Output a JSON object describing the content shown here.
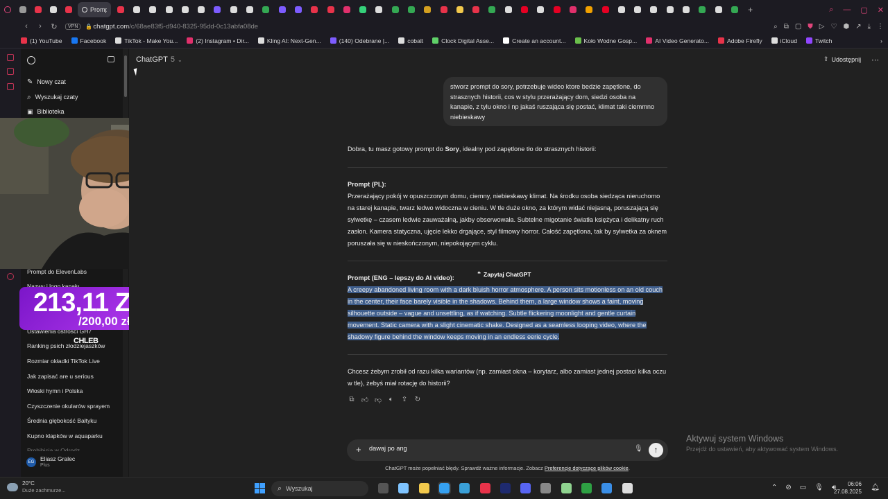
{
  "browser": {
    "active_tab_title": "Prompt",
    "url_host": "chatgpt.com",
    "url_path": "/c/68ae83f5-d940-8325-95dd-0c13abfa08de",
    "vpn_label": "VPN",
    "tab_icon_colors": [
      "#e0457b",
      "#999999",
      "#e8334a",
      "#dddddd",
      "#e8334a",
      "#e8334a",
      "#dddddd",
      "#dddddd",
      "#dddddd",
      "#dddddd",
      "#dddddd",
      "#7d5cff",
      "#dddddd",
      "#dddddd",
      "#34a853",
      "#7d5cff",
      "#7d5cff",
      "#e8334a",
      "#e8334a",
      "#e1306c",
      "#35d17a",
      "#dddddd",
      "#34a853",
      "#34a853",
      "#d4a020",
      "#e8334a",
      "#f2c94c",
      "#e8334a",
      "#34a853",
      "#dddddd",
      "#e60023",
      "#dddddd",
      "#e60023",
      "#e1306c",
      "#f2a100",
      "#e60023",
      "#dddddd",
      "#dddddd",
      "#dddddd",
      "#dddddd",
      "#dddddd",
      "#34a853",
      "#dddddd",
      "#34a853"
    ]
  },
  "bookmarks": [
    {
      "label": "(1) YouTube",
      "color": "#e8334a"
    },
    {
      "label": "Facebook",
      "color": "#1877f2"
    },
    {
      "label": "TikTok - Make You...",
      "color": "#dddddd"
    },
    {
      "label": "(2) Instagram • Dir...",
      "color": "#e1306c"
    },
    {
      "label": "Kling AI: Next-Gen...",
      "color": "#dddddd"
    },
    {
      "label": "(140) Odebrane |...",
      "color": "#7d5cff"
    },
    {
      "label": "cobalt",
      "color": "#dddddd"
    },
    {
      "label": "Clock Digital Asse...",
      "color": "#5fd068"
    },
    {
      "label": "Create an account...",
      "color": "#ffffff"
    },
    {
      "label": "Koło Wodne Gosp...",
      "color": "#6abf4b"
    },
    {
      "label": "AI Video Generato...",
      "color": "#e1306c"
    },
    {
      "label": "Adobe Firefly",
      "color": "#e8334a"
    },
    {
      "label": "iCloud",
      "color": "#dddddd"
    },
    {
      "label": "Twitch",
      "color": "#9146ff"
    }
  ],
  "sidebar": {
    "top_items": [
      {
        "label": "Nowy czat",
        "icon": "edit-icon"
      },
      {
        "label": "Wyszukaj czaty",
        "icon": "search-icon"
      },
      {
        "label": "Biblioteka",
        "icon": "library-icon"
      }
    ],
    "chats": [
      "Prompt do ElevenLabs",
      "Nazwy i logo kanału",
      "Ustawienia ostrości GH7",
      "Ranking psich złodziejaszków",
      "Rozmiar okładki TikTok Live",
      "Jak zapisać are u serious",
      "Włoski hymn i Polska",
      "Czyszczenie okularów sprayem",
      "Średnia głębokość Bałtyku",
      "Kupno klapków w aquaparku",
      "Prohibicja w Odrodz..."
    ],
    "user_name": "Eliasz Gralec",
    "user_plan": "Plus",
    "user_initials": "EG"
  },
  "overlay": {
    "donation_amount": "213,11 ZŁ",
    "donation_goal": "/200,00 zł",
    "tag": "CHLEB"
  },
  "header": {
    "model_name": "ChatGPT",
    "model_version": "5",
    "share_label": "Udostępnij"
  },
  "conversation": {
    "user_message": "stworz prompt do sory, potrzebuje wideo ktore bedzie zapętlone, do strasznych historii, cos w stylu przerażający dom, siedzi osoba na kanapie, z tylu okno i np jakaś ruszająca się postać, klimat taki ciemmno niebieskawy",
    "intro_before": "Dobra, tu masz gotowy prompt do ",
    "intro_bold": "Sory",
    "intro_after": ", idealny pod zapętlone tło do strasznych historii:",
    "pl_heading": "Prompt (PL):",
    "pl_body": "Przerażający pokój w opuszczonym domu, ciemny, niebieskawy klimat. Na środku osoba siedząca nieruchomo na starej kanapie, twarz ledwo widoczna w cieniu. W tle duże okno, za którym widać niejasną, poruszającą się sylwetkę – czasem ledwie zauważalną, jakby obserwowała. Subtelne migotanie światła księżyca i delikatny ruch zasłon. Kamera statyczna, ujęcie lekko drgające, styl filmowy horror. Całość zapętlona, tak by sylwetka za oknem poruszała się w nieskończonym, niepokojącym cyklu.",
    "eng_heading": "Prompt (ENG – lepszy do AI video):",
    "eng_body": "A creepy abandoned living room with a dark bluish horror atmosphere. A person sits motionless on an old couch in the center, their face barely visible in the shadows. Behind them, a large window shows a faint, moving silhouette outside – vague and unsettling, as if watching. Subtle flickering moonlight and gentle curtain movement. Static camera with a slight cinematic shake. Designed as a seamless looping video, where the shadowy figure behind the window keeps moving in an endless eerie cycle.",
    "ask_chip": "Zapytaj ChatGPT",
    "followup": "Chcesz żebym zrobił od razu kilka wariantów (np. zamiast okna – korytarz, albo zamiast jednej postaci kilka oczu w tle), żebyś miał rotację do historii?"
  },
  "composer": {
    "value": "dawaj po ang"
  },
  "disclaimer": {
    "text": "ChatGPT może popełniać błędy. Sprawdź ważne informacje. Zobacz ",
    "link": "Preferencje dotyczące plików cookie",
    "end": "."
  },
  "windows_activation": {
    "title": "Aktywuj system Windows",
    "subtitle": "Przejdź do ustawień, aby aktywować system Windows."
  },
  "taskbar": {
    "weather_temp": "20°C",
    "weather_desc": "Duże zachmurze...",
    "search_label": "Wyszukaj",
    "time": "06:06",
    "date": "27.08.2025",
    "app_colors": [
      "#555555",
      "#7fc4ff",
      "#f2c94c",
      "#35a0f0",
      "#3aa0d8",
      "#e8334a",
      "#1e2a6e",
      "#5865f2",
      "#888888",
      "#8fd38f",
      "#2ea043",
      "#3a8ee6",
      "#dddddd"
    ]
  }
}
